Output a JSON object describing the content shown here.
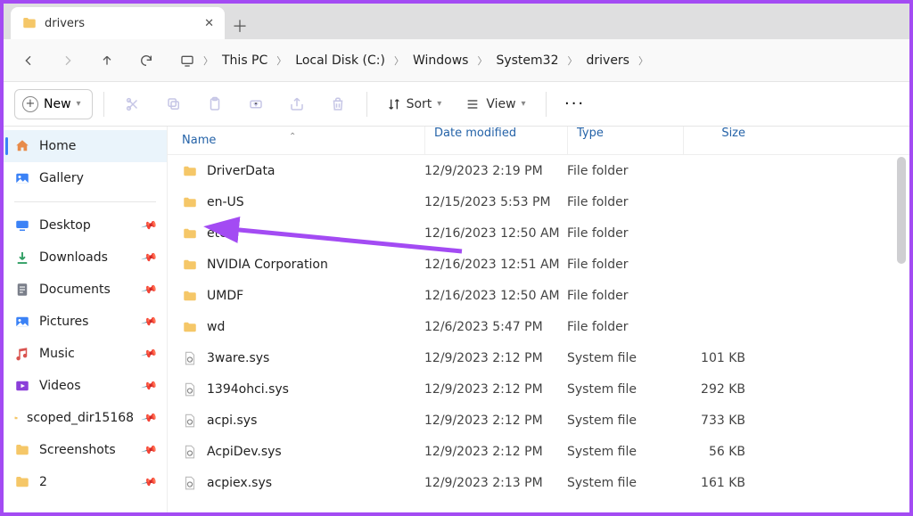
{
  "tab": {
    "title": "drivers"
  },
  "breadcrumbs": [
    "This PC",
    "Local Disk (C:)",
    "Windows",
    "System32",
    "drivers"
  ],
  "toolbar": {
    "new": "New",
    "sort": "Sort",
    "view": "View"
  },
  "sidebar": {
    "top": [
      {
        "label": "Home",
        "icon": "home",
        "active": true
      },
      {
        "label": "Gallery",
        "icon": "gallery"
      }
    ],
    "items": [
      {
        "label": "Desktop",
        "icon": "desktop"
      },
      {
        "label": "Downloads",
        "icon": "download"
      },
      {
        "label": "Documents",
        "icon": "docs"
      },
      {
        "label": "Pictures",
        "icon": "pictures"
      },
      {
        "label": "Music",
        "icon": "music"
      },
      {
        "label": "Videos",
        "icon": "videos"
      },
      {
        "label": "scoped_dir15168",
        "icon": "folder"
      },
      {
        "label": "Screenshots",
        "icon": "folder"
      },
      {
        "label": "2",
        "icon": "folder"
      }
    ]
  },
  "columns": {
    "name": "Name",
    "date": "Date modified",
    "type": "Type",
    "size": "Size"
  },
  "rows": [
    {
      "name": "DriverData",
      "date": "12/9/2023 2:19 PM",
      "type": "File folder",
      "size": "",
      "icon": "folder"
    },
    {
      "name": "en-US",
      "date": "12/15/2023 5:53 PM",
      "type": "File folder",
      "size": "",
      "icon": "folder"
    },
    {
      "name": "etc",
      "date": "12/16/2023 12:50 AM",
      "type": "File folder",
      "size": "",
      "icon": "folder"
    },
    {
      "name": "NVIDIA Corporation",
      "date": "12/16/2023 12:51 AM",
      "type": "File folder",
      "size": "",
      "icon": "folder"
    },
    {
      "name": "UMDF",
      "date": "12/16/2023 12:50 AM",
      "type": "File folder",
      "size": "",
      "icon": "folder"
    },
    {
      "name": "wd",
      "date": "12/6/2023 5:47 PM",
      "type": "File folder",
      "size": "",
      "icon": "folder"
    },
    {
      "name": "3ware.sys",
      "date": "12/9/2023 2:12 PM",
      "type": "System file",
      "size": "101 KB",
      "icon": "sysfile"
    },
    {
      "name": "1394ohci.sys",
      "date": "12/9/2023 2:12 PM",
      "type": "System file",
      "size": "292 KB",
      "icon": "sysfile"
    },
    {
      "name": "acpi.sys",
      "date": "12/9/2023 2:12 PM",
      "type": "System file",
      "size": "733 KB",
      "icon": "sysfile"
    },
    {
      "name": "AcpiDev.sys",
      "date": "12/9/2023 2:12 PM",
      "type": "System file",
      "size": "56 KB",
      "icon": "sysfile"
    },
    {
      "name": "acpiex.sys",
      "date": "12/9/2023 2:13 PM",
      "type": "System file",
      "size": "161 KB",
      "icon": "sysfile"
    }
  ]
}
